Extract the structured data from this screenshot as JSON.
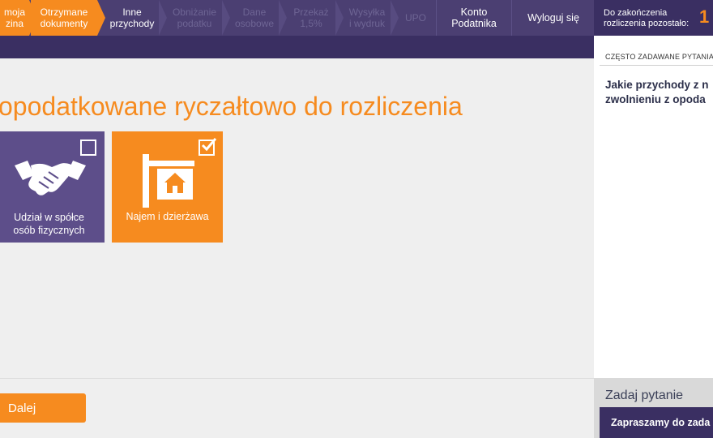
{
  "nav": {
    "steps": [
      {
        "label": "moja\nzina",
        "state": "done"
      },
      {
        "label": "Otrzymane\ndokumenty",
        "state": "done"
      },
      {
        "label": "Inne\nprzychody",
        "state": "current"
      },
      {
        "label": "Obniżanie\npodatku",
        "state": "disabled"
      },
      {
        "label": "Dane\nosobowe",
        "state": "disabled"
      },
      {
        "label": "Przekaż\n1,5%",
        "state": "disabled"
      },
      {
        "label": "Wysyłka\ni wydruk",
        "state": "disabled"
      },
      {
        "label": "UPO",
        "state": "disabled"
      }
    ],
    "account_label": "Konto\nPodatnika",
    "logout_label": "Wyloguj się"
  },
  "main": {
    "title": "opodatkowane ryczałtowo do rozliczenia",
    "tiles": [
      {
        "label": "Udział w spółce\nosób fizycznych",
        "checked": false,
        "icon": "handshake-icon",
        "color": "#5d4e8a"
      },
      {
        "label": "Najem i dzierżawa",
        "checked": true,
        "icon": "house-sign-icon",
        "color": "#f68b1f"
      }
    ],
    "next_label": "Dalej"
  },
  "sidebar": {
    "deadline_label": "Do zakończenia\nrozliczenia pozostało:",
    "counter": "1",
    "faq_header": "CZĘSTO ZADAWANE PYTANIA",
    "faq_question": "Jakie przychody z n\nzwolnieniu z opoda",
    "ask_title": "Zadaj pytanie",
    "ask_banner": "Zapraszamy do zada"
  },
  "colors": {
    "accent": "#f68b1f",
    "nav_bg": "#4b3f72",
    "nav_dark": "#3a2f62"
  }
}
